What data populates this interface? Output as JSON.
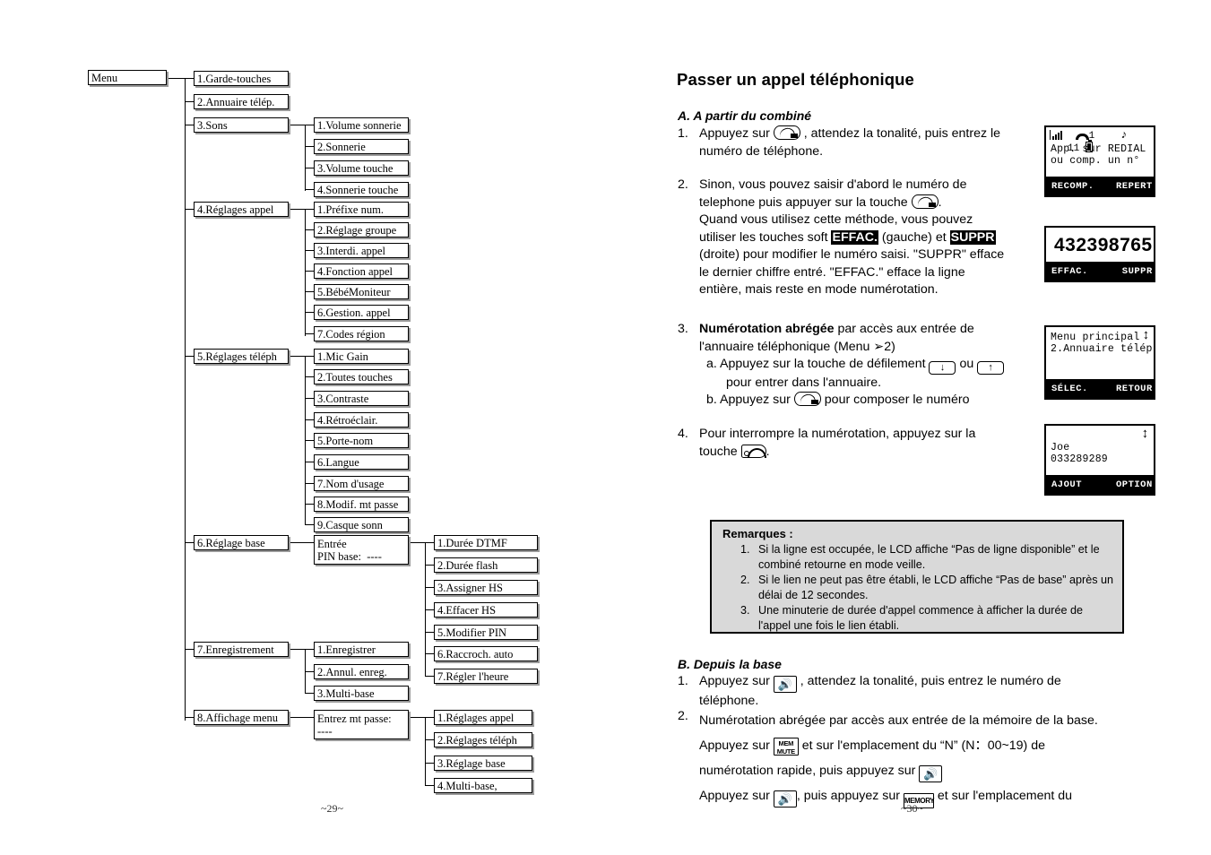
{
  "left_page": {
    "page_number": "~29~",
    "root": "Menu",
    "level1": [
      "1.Garde-touches",
      "2.Annuaire télép.",
      "3.Sons",
      "4.Réglages appel",
      "5.Réglages téléph",
      "6.Réglage base",
      "7.Enregistrement",
      "8.Affichage menu"
    ],
    "sons_children": [
      "1.Volume sonnerie",
      "2.Sonnerie",
      "3.Volume touche",
      "4.Sonnerie touche"
    ],
    "reglages_appel_children": [
      "1.Préfixe num.",
      "2.Réglage groupe",
      "3.Interdi. appel",
      "4.Fonction appel",
      "5.BébéMoniteur",
      "6.Gestion. appel",
      "7.Codes région"
    ],
    "reglages_teleph_children": [
      "1.Mic Gain",
      "2.Toutes touches",
      "3.Contraste",
      "4.Rétroéclair.",
      "5.Porte-nom",
      "6.Langue",
      "7.Nom d'usage",
      "8.Modif. mt passe",
      "9.Casque sonn"
    ],
    "reglage_base_gate": "Entrée\nPIN base:  ----",
    "reglage_base_children": [
      "1.Durée DTMF",
      "2.Durée flash",
      "3.Assigner HS",
      "4.Effacer HS",
      "5.Modifier PIN",
      "6.Raccroch. auto",
      "7.Régler l'heure"
    ],
    "enregistrement_children": [
      "1.Enregistrer",
      "2.Annul. enreg.",
      "3.Multi-base"
    ],
    "affichage_menu_gate": "Entrez mt passe:\n----",
    "affichage_menu_children": [
      "1.Réglages appel",
      "2.Réglages téléph",
      "3.Réglage base",
      "4.Multi-base,"
    ]
  },
  "right_page": {
    "page_number": "~30~",
    "title": "Passer un appel téléphonique",
    "section_a": {
      "heading": "A. A partir du combiné",
      "item1": {
        "num": "1.",
        "part1": "Appuyez sur",
        "part2": ", attendez la tonalité, puis entrez le",
        "line2": "numéro de téléphone."
      },
      "item2": {
        "num": "2.",
        "line1": "Sinon, vous pouvez saisir d'abord le numéro de",
        "line2a": "telephone puis appuyer sur la touche",
        "line2b": ".",
        "line3": "Quand vous utilisez cette méthode, vous pouvez",
        "line4a": "utiliser les touches soft",
        "key_effac": "EFFAC.",
        "line4b": "(gauche) et",
        "key_suppr": "SUPPR",
        "line5": "(droite) pour modifier le numéro saisi.  \"SUPPR\" efface",
        "line6": "le dernier chiffre entré.  \"EFFAC.\" efface la ligne",
        "line7": "entière, mais reste en mode numérotation."
      },
      "item3": {
        "num": "3.",
        "bold": "Numérotation abrégée",
        "line1_rest": "par accès aux entrée de",
        "line2": "l'annuaire téléphonique (Menu ➢2)",
        "sub_a_label": "a.",
        "sub_a_1": "Appuyez sur la touche de défilement",
        "sub_a_or": "ou",
        "sub_a_2": "pour entrer dans l'annuaire.",
        "sub_b_label": "b.",
        "sub_b_1": "Appuyez sur",
        "sub_b_2": "pour composer le numéro"
      },
      "item4": {
        "num": "4.",
        "line1": "Pour interrompre la numérotation, appuyez sur la",
        "line2a": "touche",
        "line2b": "."
      }
    },
    "lcd_screens": [
      {
        "name": "redial-prompt",
        "status": {
          "handset_number": "1",
          "counter": "11"
        },
        "lines": [
          "App. sur REDIAL",
          "ou comp. un n°"
        ],
        "soft_left": "RECOMP.",
        "soft_right": "REPERT"
      },
      {
        "name": "dialed-number",
        "big_number": "432398765",
        "soft_left": "EFFAC.",
        "soft_right": "SUPPR"
      },
      {
        "name": "main-menu",
        "lines": [
          "Menu principal",
          "2.Annuaire télép."
        ],
        "soft_left": "SÉLEC.",
        "soft_right": "RETOUR"
      },
      {
        "name": "phonebook-entry",
        "lines": [
          "Joe",
          "033289289"
        ],
        "soft_left": "AJOUT",
        "soft_right": "OPTION"
      }
    ],
    "remarks": {
      "title": "Remarques :",
      "items": [
        "Si la ligne est occupée, le LCD affiche “Pas de ligne disponible” et le combiné retourne en mode veille.",
        "Si le lien ne peut pas être établi, le LCD affiche “Pas de base” après un délai de 12 secondes.",
        "Une minuterie de durée d'appel commence à afficher la durée de l'appel une fois le lien établi."
      ]
    },
    "section_b": {
      "heading": "B. Depuis la base",
      "item1": {
        "num": "1.",
        "part1": "Appuyez sur",
        "part2": ", attendez la tonalité, puis entrez le numéro de",
        "line2": "téléphone."
      },
      "item2": {
        "num": "2.",
        "line1": "Numérotation abrégée par accès aux entrée de la mémoire de la base.",
        "line2a": "Appuyez sur",
        "key_mem": "MEM\nMUTE",
        "line2b": "et sur l'emplacement du “N” (N：00~19) de",
        "line3a": "numérotation rapide, puis appuyez sur",
        "line4a": "Appuyez sur",
        "line4b": ", puis appuyez sur",
        "key_memory": "MEMORY",
        "line4c": "et sur l'emplacement du"
      }
    }
  }
}
